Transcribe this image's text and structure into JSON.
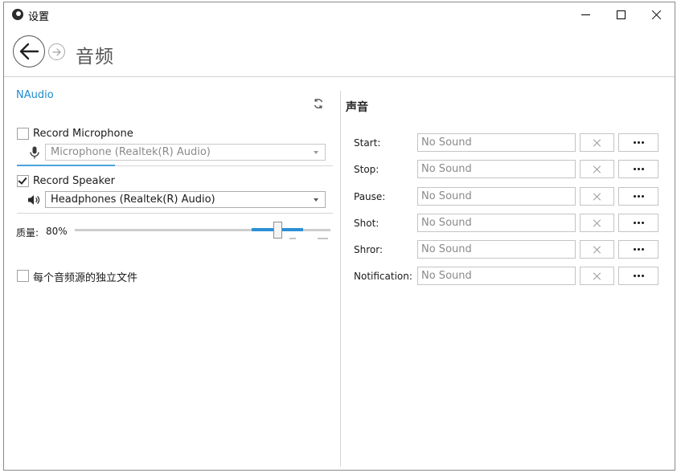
{
  "window": {
    "title": "设置",
    "controls": {
      "minimize": "minimize-icon",
      "maximize": "maximize-icon",
      "close": "close-icon"
    }
  },
  "header": {
    "page_title": "音频",
    "back_icon": "arrow-left-icon",
    "forward_icon": "arrow-right-icon"
  },
  "audio": {
    "provider": "NAudio",
    "refresh_icon": "refresh-icon",
    "microphone": {
      "label": "Record Microphone",
      "checked": false,
      "device": "Microphone (Realtek(R) Audio)",
      "icon": "microphone-icon"
    },
    "speaker": {
      "label": "Record Speaker",
      "checked": true,
      "device": "Headphones (Realtek(R) Audio)",
      "icon": "speaker-icon"
    },
    "quality": {
      "label": "质量:",
      "value_text": "80%",
      "value": 0.8
    },
    "separate_files": {
      "label": "每个音频源的独立文件",
      "checked": false
    }
  },
  "sounds": {
    "title": "声音",
    "items": [
      {
        "label": "Start:",
        "value": "No Sound"
      },
      {
        "label": "Stop:",
        "value": "No Sound"
      },
      {
        "label": "Pause:",
        "value": "No Sound"
      },
      {
        "label": "Shot:",
        "value": "No Sound"
      },
      {
        "label": "Shror:",
        "value": "No Sound"
      },
      {
        "label": "Notification:",
        "value": "No Sound"
      }
    ]
  },
  "colors": {
    "accent": "#1e8bcd",
    "slider_fill": "#2a8fd6"
  }
}
